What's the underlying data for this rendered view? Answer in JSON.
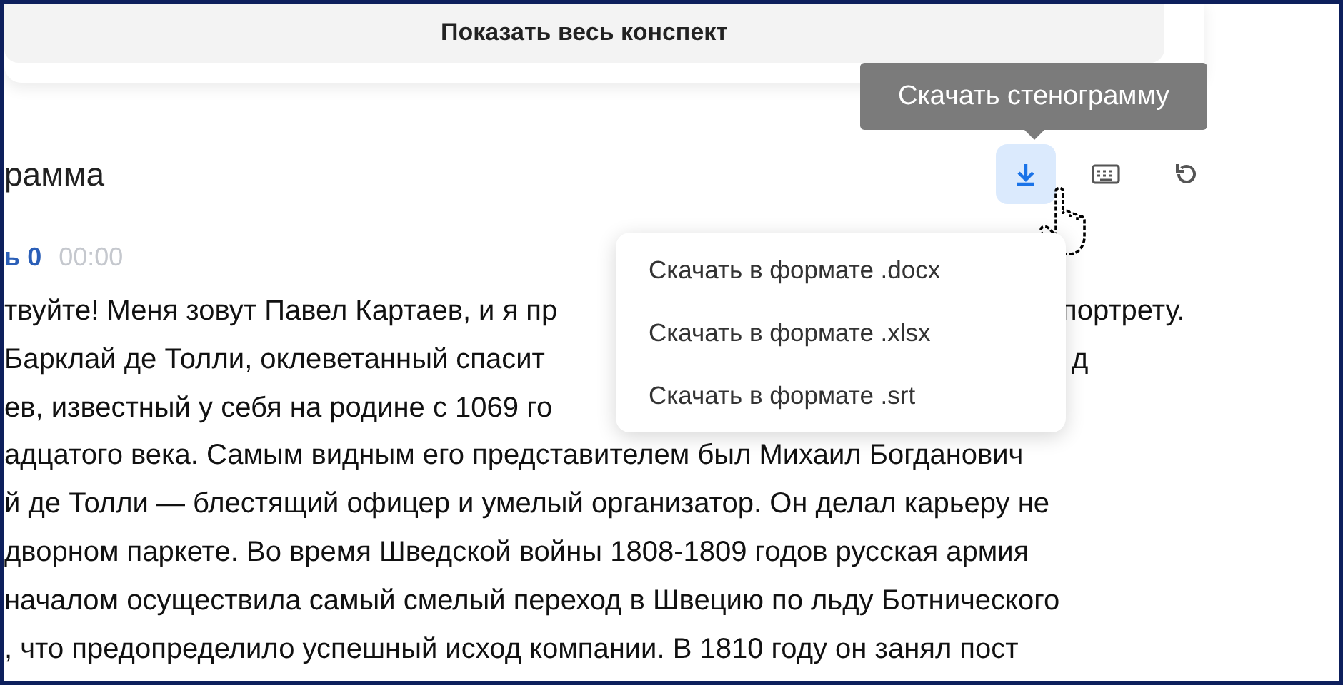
{
  "summary_button": "Показать весь конспект",
  "section_title": "рамма",
  "toolbar": [
    {
      "kind": "download",
      "selected": true
    },
    {
      "kind": "keyboard",
      "selected": false
    },
    {
      "kind": "undo",
      "selected": false
    }
  ],
  "tooltip": "Скачать стенограмму",
  "speaker": {
    "name": "ь 0",
    "time": "00:00"
  },
  "lines": [
    {
      "text": "твуйте! Меня зовут Павел Картаев, и я пр",
      "tail": "портрету."
    },
    {
      "text": "Барклай де Толли, оклеветанный спасит",
      "tail": "д"
    },
    {
      "text": "ев, известный у себя на родине с 1069 го"
    },
    {
      "text": "адцатого века. Самым видным его представителем был Михаил Богданович"
    },
    {
      "text": "й де Толли — блестящий офицер и умелый организатор. Он делал карьеру не"
    },
    {
      "text": "дворном паркете. Во время Шведской войны 1808-1809 годов русская армия"
    },
    {
      "text": "началом осуществила самый смелый переход в Швецию по льду Ботнического"
    },
    {
      "text": ", что предопределило успешный исход компании. В 1810 году он занял пост"
    }
  ],
  "menu": [
    "Скачать в формате .docx",
    "Скачать в формате .xlsx",
    "Скачать в формате .srt"
  ]
}
